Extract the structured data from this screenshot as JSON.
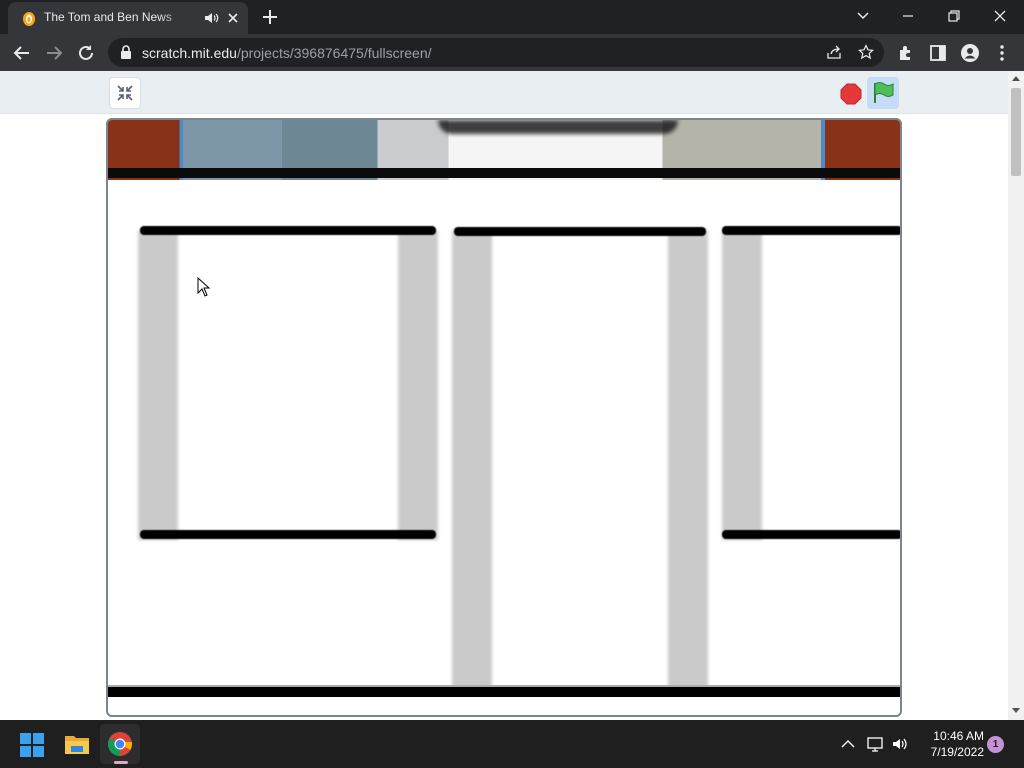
{
  "browser": {
    "tab": {
      "title": "The Tom and Ben News Show",
      "favicon": "scratch-cat-favicon",
      "audio_icon": "speaker-icon",
      "close_icon": "close-icon"
    },
    "new_tab_icon": "plus-icon",
    "tab_search_icon": "chevron-down-icon",
    "window_controls": [
      "minimize-icon",
      "restore-icon",
      "close-icon"
    ],
    "toolbar": {
      "back_icon": "back-arrow-icon",
      "forward_icon": "forward-arrow-icon",
      "reload_icon": "reload-icon",
      "url_host": "scratch.mit.edu",
      "url_path": "/projects/396876475/fullscreen/",
      "right_icons": [
        "share-icon",
        "star-icon",
        "extensions-icon",
        "side-panel-icon",
        "profile-icon",
        "kebab-menu-icon"
      ]
    }
  },
  "scratch_player": {
    "unfullscreen_icon": "shrink-icon",
    "stop_icon": "stop-sign-icon",
    "green_flag_icon": "green-flag-icon"
  },
  "taskbar": {
    "apps": [
      "windows-start-icon",
      "file-explorer-icon",
      "chrome-icon"
    ],
    "tray_icons": [
      "chevron-up-icon",
      "network-icon",
      "volume-icon"
    ],
    "time": "10:46 AM",
    "date": "7/19/2022",
    "notification_count": "1"
  },
  "colors": {
    "chrome_dark": "#202124",
    "chrome_toolbar": "#35363a",
    "scratch_bar": "#e9eef2",
    "stop_red": "#e5383b",
    "flag_green": "#4cbf56",
    "taskbar": "#1f1f1f"
  }
}
